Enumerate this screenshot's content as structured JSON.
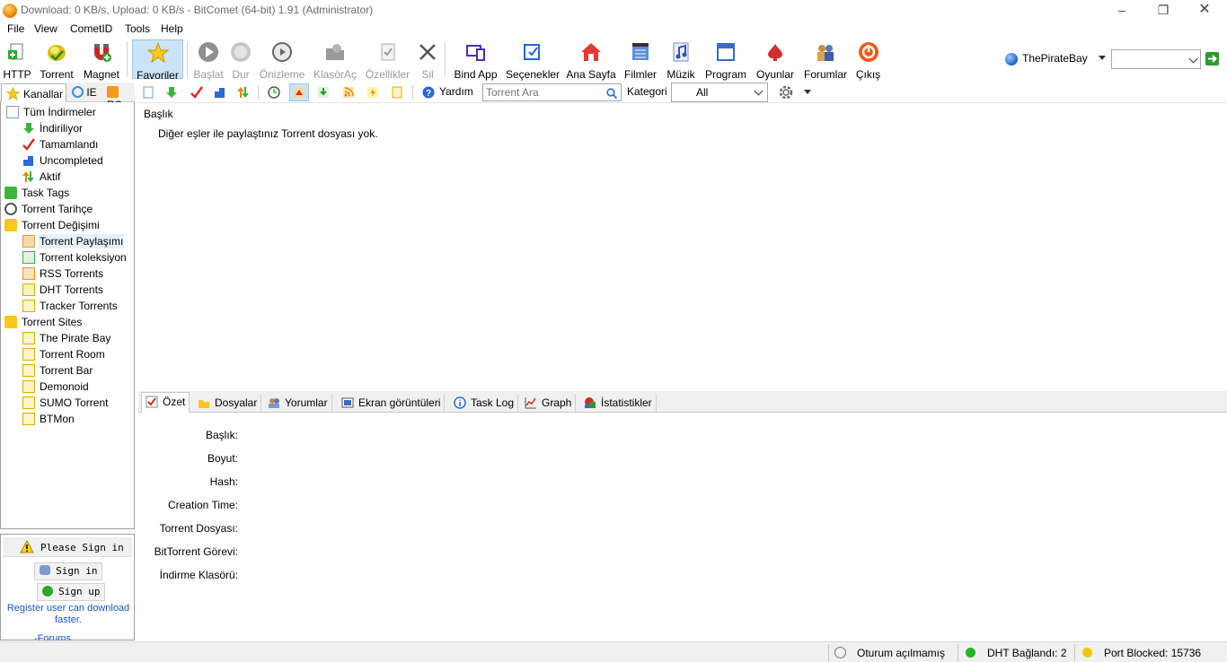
{
  "window": {
    "title": "Download: 0 KB/s, Upload: 0 KB/s - BitComet (64-bit) 1.91 (Administrator)"
  },
  "menu": [
    "File",
    "View",
    "CometID",
    "Tools",
    "Help"
  ],
  "toolbar": {
    "http": "HTTP",
    "torrent": "Torrent",
    "magnet": "Magnet",
    "favorites": "Favoriler",
    "start": "Başlat",
    "stop": "Dur",
    "preview": "Önizleme",
    "open_folder": "KlasörAç",
    "properties": "Özellikler",
    "delete": "Sil",
    "bind_app": "Bind App",
    "options": "Seçenekler",
    "home": "Ana Sayfa",
    "movies": "Filmler",
    "music": "Müzik",
    "program": "Program",
    "games": "Oyunlar",
    "forums": "Forumlar",
    "exit": "Çıkış"
  },
  "site_selector": {
    "name": "ThePirateBay",
    "value": ""
  },
  "left_tabs": {
    "channels": "Kanallar",
    "ie": "IE",
    "rss": "RS"
  },
  "tree": {
    "all_downloads": "Tüm İndirmeler",
    "downloading": "İndiriliyor",
    "completed": "Tamamlandı",
    "uncompleted": "Uncompleted",
    "active": "Aktif",
    "task_tags": "Task Tags",
    "torrent_history": "Torrent Tarihçe",
    "torrent_exchange": "Torrent Değişimi",
    "torrent_sharing": "Torrent Paylaşımı",
    "torrent_collection": "Torrent koleksiyon",
    "rss_torrents": "RSS Torrents",
    "dht_torrents": "DHT Torrents",
    "tracker_torrents": "Tracker Torrents",
    "torrent_sites": "Torrent Sites",
    "sites": [
      "The Pirate Bay",
      "Torrent Room",
      "Torrent Bar",
      "Demonoid",
      "SUMO Torrent",
      "BTMon"
    ]
  },
  "sign": {
    "please": "Please Sign in",
    "signin": "Sign in",
    "signup": "Sign up",
    "register_note": "Register user can download faster.",
    "forums": "-Forums"
  },
  "toolbar2": {
    "help": "Yardım",
    "search_placeholder": "Torrent Ara",
    "category_label": "Kategori",
    "category_value": "All"
  },
  "main": {
    "column_title": "Başlık",
    "empty_message": "Diğer eşler ile paylaştınız Torrent dosyası yok."
  },
  "bottom_tabs": {
    "summary": "Özet",
    "files": "Dosyalar",
    "comments": "Yorumlar",
    "screenshots": "Ekran görüntüleri",
    "task_log": "Task Log",
    "graph": "Graph",
    "stats": "İstatistikler"
  },
  "details": {
    "title": "Başlık:",
    "size": "Boyut:",
    "hash": "Hash:",
    "creation_time": "Creation Time:",
    "torrent_file": "Torrent Dosyası:",
    "bt_task": "BitTorrent Görevi:",
    "download_folder": "İndirme Klasörü:"
  },
  "status": {
    "session": "Oturum açılmamış",
    "dht": "DHT Bağlandı: 2",
    "port": "Port Blocked: 15736"
  },
  "colors": {
    "accent_selected": "#cce4f7",
    "dht_green": "#1fb81f",
    "port_yellow": "#f5c400",
    "link_blue": "#1a56c8"
  }
}
